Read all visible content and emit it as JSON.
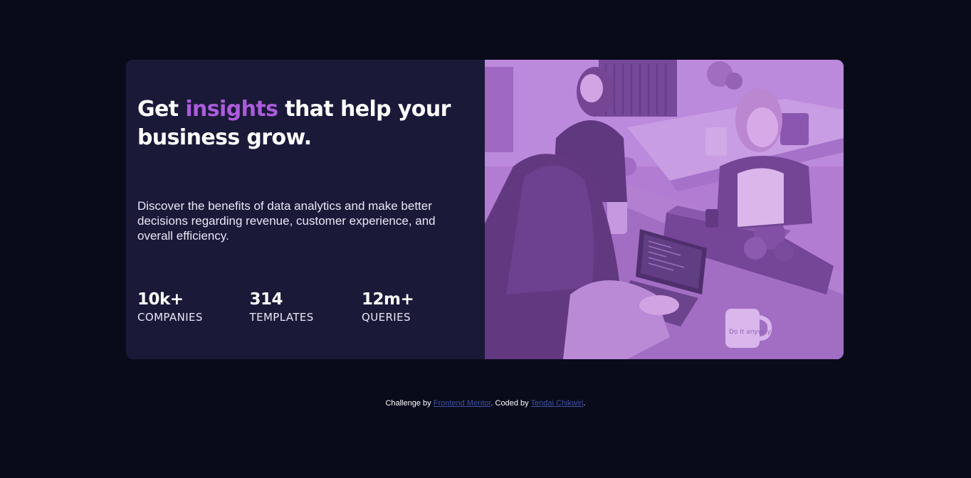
{
  "card": {
    "heading": {
      "before": "Get ",
      "accent": "insights",
      "after": " that help your business grow."
    },
    "description": "Discover the benefits of data analytics and make better decisions regarding revenue, customer experience, and overall efficiency.",
    "stats": [
      {
        "value": "10k+",
        "label": "COMPANIES"
      },
      {
        "value": "314",
        "label": "TEMPLATES"
      },
      {
        "value": "12m+",
        "label": "QUERIES"
      }
    ],
    "image": {
      "mug_text": "Do it anyway"
    }
  },
  "footer": {
    "prefix": "Challenge by ",
    "link1": "Frontend Mentor",
    "middle": ". Coded by ",
    "link2": "Tendai Chikwiri",
    "suffix": "."
  },
  "colors": {
    "page_bg": "#090b1b",
    "card_bg": "#1b1938",
    "accent": "#ab5cdb",
    "image_tint": "#aa5cdb",
    "link": "#3e52a3"
  }
}
